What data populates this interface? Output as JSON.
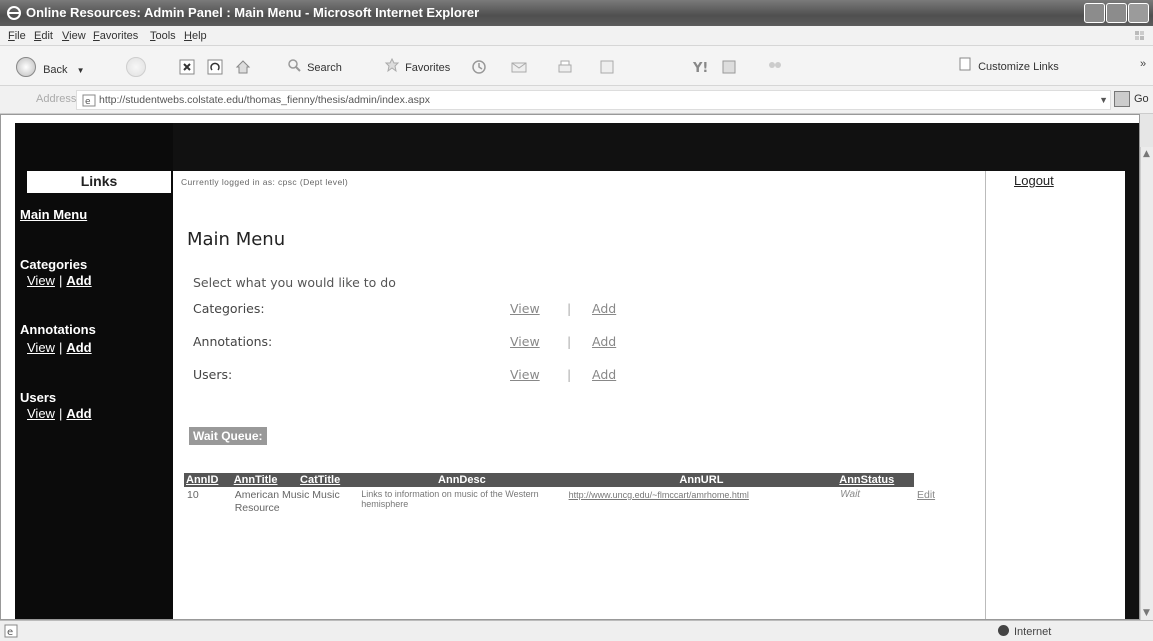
{
  "window": {
    "title": "Online Resources: Admin Panel : Main Menu - Microsoft Internet Explorer"
  },
  "menubar": {
    "items": [
      "File",
      "Edit",
      "View",
      "Favorites",
      "Tools",
      "Help"
    ]
  },
  "toolbar": {
    "back_label": "Back",
    "search_label": "Search",
    "favorites_label": "Favorites",
    "customize_label": "Customize Links"
  },
  "address": {
    "label": "Address",
    "url": "http://studentwebs.colstate.edu/thomas_fienny/thesis/admin/index.aspx",
    "go_label": "Go"
  },
  "sidebar": {
    "header": "Links",
    "main_menu": "Main Menu",
    "sections": [
      {
        "title": "Categories",
        "view": "View",
        "add": "Add"
      },
      {
        "title": "Annotations",
        "view": "View",
        "add": "Add"
      },
      {
        "title": "Users",
        "view": "View",
        "add": "Add"
      }
    ],
    "separator": "|"
  },
  "main": {
    "logged_in": "Currently logged in as: cpsc (Dept level)",
    "title": "Main Menu",
    "prompt": "Select what you would like to do",
    "rows": [
      {
        "label": "Categories:",
        "view": "View",
        "sep": "|",
        "add": "Add"
      },
      {
        "label": "Annotations:",
        "view": "View",
        "sep": "|",
        "add": "Add"
      },
      {
        "label": "Users:",
        "view": "View",
        "sep": "|",
        "add": "Add"
      }
    ],
    "wait_queue": "Wait Queue:"
  },
  "queue_table": {
    "headers": [
      "AnnID",
      "AnnTitle",
      "CatTitle",
      "AnnDesc",
      "AnnURL",
      "AnnStatus"
    ],
    "rows": [
      {
        "id": "10",
        "title": "American Music Music Resource",
        "cat": "",
        "desc": "Links to information on music of the Western hemisphere",
        "url": "http://www.uncg.edu/~flmccart/amrhome.html",
        "status": "Wait",
        "edit": "Edit"
      }
    ]
  },
  "right_panel": {
    "logout": "Logout"
  },
  "statusbar": {
    "zone": "Internet"
  },
  "colors": {
    "sidebar_bg": "#0b0b0b",
    "titlebar": "#5c5c5c",
    "header_bg": "#555555"
  }
}
